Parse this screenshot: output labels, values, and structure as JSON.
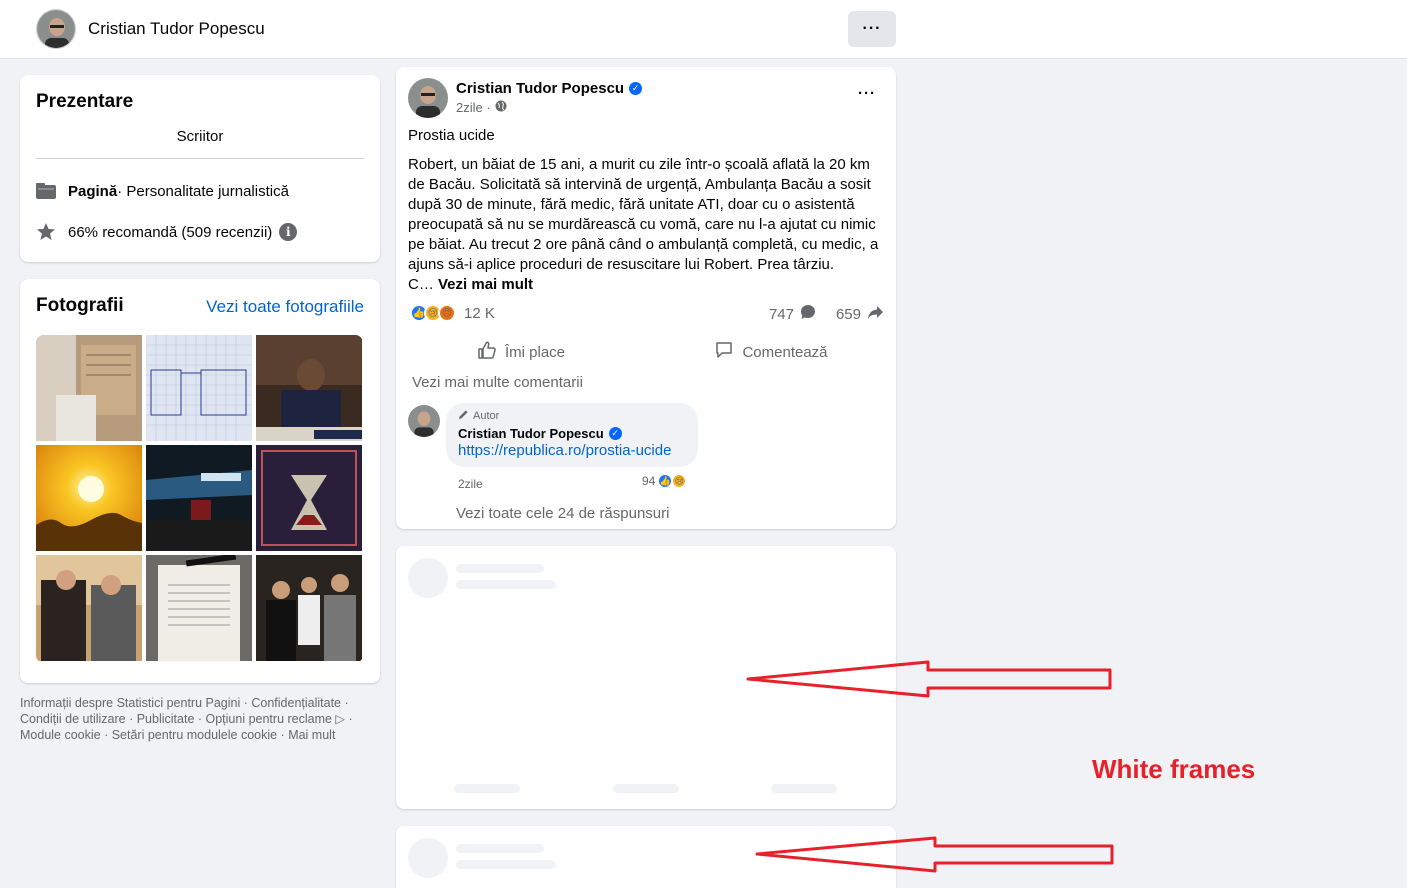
{
  "header": {
    "name": "Cristian Tudor Popescu",
    "more_label": "···"
  },
  "intro": {
    "title": "Prezentare",
    "occupation": "Scriitor",
    "page_type_bold": "Pagină",
    "page_type_rest": " · Personalitate jurnalistică",
    "recommend": "66% recomandă (509 recenzii)",
    "info_icon": "i"
  },
  "photos": {
    "title": "Fotografii",
    "see_all": "Vezi toate fotografiile"
  },
  "footer": {
    "text": "Informații despre Statistici pentru Pagini · Confidențialitate · Condiții de utilizare · Publicitate · Opțiuni pentru reclame ▷ · Module cookie · Setări pentru modulele cookie · Mai mult"
  },
  "post": {
    "author": "Cristian Tudor Popescu",
    "time": "2zile ·",
    "more": "···",
    "headline": "Prostia ucide",
    "body": " Robert, un băiat de 15 ani, a murit cu zile într-o școală aflată la 20 km de Bacău. Solicitată să intervină de urgență, Ambulanța Bacău a sosit după 30 de minute, fără medic, fără unitate ATI, doar cu o asistentă preocupată să nu se murdărească cu vomă, care nu l-a ajutat cu nimic pe băiat. Au trecut 2 ore până când o ambulanță completă, cu medic, a ajuns să-i aplice proceduri de resuscitare lui Robert. Prea târziu.",
    "body_tail": " C… ",
    "see_more": "Vezi mai mult",
    "reaction_count": "12 K",
    "comment_count": "747",
    "share_count": "659",
    "like_label": "Îmi place",
    "comment_label": "Comentează",
    "more_comments": "Vezi mai multe comentarii",
    "comment": {
      "badge": "Autor",
      "name": "Cristian Tudor Popescu",
      "link": "https://republica.ro/prostia-ucide",
      "time": "2zile",
      "reactions": "94"
    },
    "replies": "Vezi toate cele 24 de răspunsuri"
  },
  "annotation": {
    "label": "White frames",
    "color": "#e8202a"
  },
  "colors": {
    "background": "#f0f2f5",
    "link": "#0064d1",
    "verified": "#0866ff",
    "like": "#1877f2"
  }
}
